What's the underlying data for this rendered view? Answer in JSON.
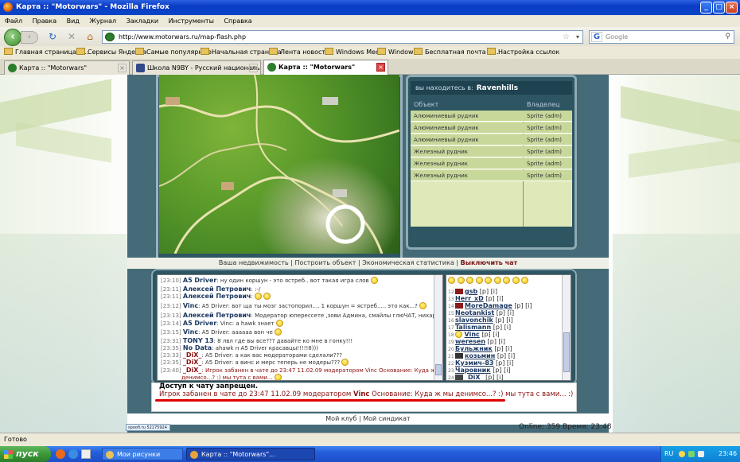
{
  "window": {
    "title": "Карта :: \"Motorwars\" - Mozilla Firefox"
  },
  "menu": [
    "Файл",
    "Правка",
    "Вид",
    "Журнал",
    "Закладки",
    "Инструменты",
    "Справка"
  ],
  "address": {
    "url": "http://www.motorwars.ru/map-flash.php"
  },
  "search": {
    "placeholder": "Google"
  },
  "bookmarks": [
    "Главная страница Я...",
    "Сервисы Яндекса",
    "Самые популярные",
    "Начальная страница",
    "Лента новостей",
    "Windows Media",
    "Windows",
    "Бесплатная почта H...",
    "Настройка ссылок"
  ],
  "tabs": [
    "Карта :: \"Motorwars\"",
    "Школа N9BY - Русский национальный...",
    "Карта :: \"Motorwars\""
  ],
  "location": {
    "label": "вы находитесь в:",
    "value": "Ravenhills"
  },
  "objects": {
    "header_object": "Объект",
    "header_owner": "Владелец",
    "rows": [
      {
        "object": "Алюминиевый рудник",
        "owner": "Sprite (adm)"
      },
      {
        "object": "Алюминиевый рудник",
        "owner": "Sprite (adm)"
      },
      {
        "object": "Алюминиевый рудник",
        "owner": "Sprite (adm)"
      },
      {
        "object": "Железный рудник",
        "owner": "Sprite (adm)"
      },
      {
        "object": "Железный рудник",
        "owner": "Sprite (adm)"
      },
      {
        "object": "Железный рудник",
        "owner": "Sprite (adm)"
      }
    ]
  },
  "links": {
    "realty": "Ваша недвижимость",
    "build": "Построить объект",
    "stats": "Экономическая статистика",
    "chat_off": "Выключить чат"
  },
  "chat": [
    {
      "ts": "[23:10]",
      "nick": "A5 Driver",
      "text": ": ну один коршун - это ястреб.. вот такая игра слов"
    },
    {
      "ts": "[23:11]",
      "nick": "Алексей Петрович",
      "text": ": :-/"
    },
    {
      "ts": "[23:11]",
      "nick": "Алексей Петрович",
      "text": ":"
    },
    {
      "ts": "[23:12]",
      "nick": "Vinc",
      "text": ": A5 Driver: вот ща ты мозг застопорил.... 1 коршун = ястреб..... это как...?"
    },
    {
      "ts": "[23:13]",
      "nick": "Алексей Петрович",
      "text": ": Модератор юперессете ,зови Админа, смайлы глюЧАТ, нихарашо как-то"
    },
    {
      "ts": "[23:14]",
      "nick": "A5 Driver",
      "text": ": Vinc: а hawk знает"
    },
    {
      "ts": "[23:15]",
      "nick": "Vinc",
      "text": ": A5 Driver: аааааа вон че"
    },
    {
      "ts": "[23:31]",
      "nick": "TONY 13",
      "text": ": 8 лвл где вы все??? давайте ко мне в гонку!!!"
    },
    {
      "ts": "[23:35]",
      "nick": "No Data",
      "text": ": ahawk н A5 Driver красавцы!!!!!8)))"
    },
    {
      "ts": "[23:33]",
      "nick": "_DiX_",
      "text": ": A5 Driver: а как вас модераторами сделали???"
    },
    {
      "ts": "[23:35]",
      "nick": "_DiX_",
      "text": ": A5 Driver: а винс и мерс теперь не модеры???"
    },
    {
      "ts": "[23:40]",
      "nick": "_DiX_",
      "text": ": Игрок забанен в чате до 23:47 11.02.09 модератором Vinc Основание: Куда ж мы"
    },
    {
      "ts": "",
      "nick": "",
      "text": "денимсо...? :) мы тута с вами..."
    }
  ],
  "users": [
    {
      "num": "12",
      "name": "gsb",
      "tags": "[p] [i]"
    },
    {
      "num": "13",
      "name": "Herr_xD",
      "tags": "[p] [i]"
    },
    {
      "num": "14",
      "name": "MoreDamage",
      "tags": "[p] [i]"
    },
    {
      "num": "15",
      "name": "Neotankist",
      "tags": "[p] [i]"
    },
    {
      "num": "16",
      "name": "slavonchik",
      "tags": "[p] [i]"
    },
    {
      "num": "17",
      "name": "Talismann",
      "tags": "[p] [i]"
    },
    {
      "num": "18",
      "name": "Vinc",
      "tags": "[p] [i]"
    },
    {
      "num": "19",
      "name": "weresen",
      "tags": "[p] [i]"
    },
    {
      "num": "20",
      "name": "Бульжник",
      "tags": "[p] [i]"
    },
    {
      "num": "21",
      "name": "козьмин",
      "tags": "[p] [i]"
    },
    {
      "num": "22",
      "name": "Кузмич-83",
      "tags": "[p] [i]"
    },
    {
      "num": "23",
      "name": "Чаровник",
      "tags": "[p] [i]"
    },
    {
      "num": "24",
      "name": "_DiX_",
      "tags": "[p] [i]"
    }
  ],
  "status": {
    "denied": "Доступ к чату запрещен.",
    "ban_prefix": "Игрок забанен в чате до 23:47 11.02.09 модератором ",
    "ban_mod": "Vinc",
    "ban_suffix": " Основание: Куда ж мы денимсо...? :) мы тута с вами... :)"
  },
  "footer": {
    "my_club": "Мой клуб",
    "my_syndicate": "Мой синдикат",
    "counter": "spoofi.ru 52175924",
    "online": "Online: 359  Время: 23:48"
  },
  "browser_status": "Готово",
  "taskbar": {
    "start": "пуск",
    "tasks": [
      "Мои рисунки",
      "Карта :: \"Motorwars\"..."
    ],
    "lang": "RU",
    "clock": "23:46"
  }
}
